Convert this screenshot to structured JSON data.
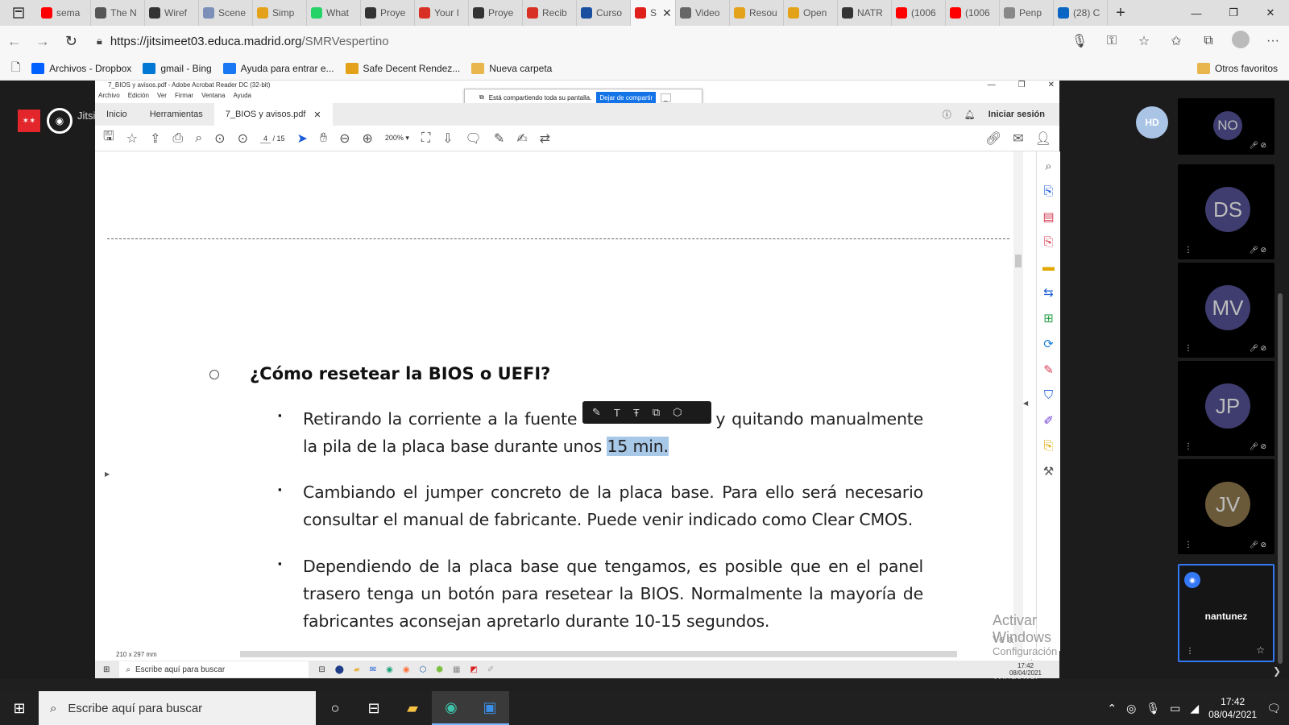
{
  "browser": {
    "tabs": [
      {
        "label": "sema",
        "icon": "youtube-icon",
        "color": "#ff0000"
      },
      {
        "label": "The N",
        "icon": "medium-icon",
        "color": "#555555"
      },
      {
        "label": "Wiref",
        "icon": "github-icon",
        "color": "#333333"
      },
      {
        "label": "Scene",
        "icon": "globe-icon",
        "color": "#7b8fb8"
      },
      {
        "label": "Simp",
        "icon": "fox-icon",
        "color": "#e3a21a"
      },
      {
        "label": "What",
        "icon": "whatsapp-icon",
        "color": "#25d366"
      },
      {
        "label": "Proye",
        "icon": "notebook-icon",
        "color": "#333333"
      },
      {
        "label": "Your I",
        "icon": "gmail-icon",
        "color": "#d93025"
      },
      {
        "label": "Proye",
        "icon": "notebook-icon",
        "color": "#333333"
      },
      {
        "label": "Recib",
        "icon": "gmail-icon",
        "color": "#d93025"
      },
      {
        "label": "Curso",
        "icon": "graduation-icon",
        "color": "#1a4fa0"
      },
      {
        "label": "S",
        "icon": "record-icon",
        "color": "#e0201b",
        "active": true
      },
      {
        "label": "Video",
        "icon": "shield-icon",
        "color": "#666666"
      },
      {
        "label": "Resou",
        "icon": "smiley-icon",
        "color": "#e3a21a"
      },
      {
        "label": "Open",
        "icon": "fox-icon",
        "color": "#e3a21a"
      },
      {
        "label": "NATR",
        "icon": "circle-icon",
        "color": "#333333"
      },
      {
        "label": "(1006",
        "icon": "youtube-icon",
        "color": "#ff0000"
      },
      {
        "label": "(1006",
        "icon": "youtube-icon",
        "color": "#ff0000"
      },
      {
        "label": "Penp",
        "icon": "box-icon",
        "color": "#888888"
      },
      {
        "label": "(28) C",
        "icon": "mail-icon",
        "color": "#0a66c2"
      }
    ],
    "url_host": "https://jitsimeet03.educa.madrid.org",
    "url_path": "/SMRVespertino",
    "favorites": [
      {
        "label": "Archivos - Dropbox",
        "icon": "dropbox-icon",
        "color": "#0061ff"
      },
      {
        "label": "gmail - Bing",
        "icon": "bing-icon",
        "color": "#0078d4"
      },
      {
        "label": "Ayuda para entrar e...",
        "icon": "facebook-icon",
        "color": "#1877f2"
      },
      {
        "label": "Safe Decent Rendez...",
        "icon": "fox-icon",
        "color": "#e3a21a"
      },
      {
        "label": "Nueva carpeta",
        "icon": "folder-icon",
        "color": "#e8b64c"
      }
    ],
    "other_favorites": "Otros favoritos"
  },
  "meeting": {
    "participants": [
      {
        "initials": "NO"
      },
      {
        "initials": "DS"
      },
      {
        "initials": "MV"
      },
      {
        "initials": "JP"
      },
      {
        "initials": "JV"
      }
    ],
    "self_initials": "HD",
    "active_speaker": "nantunez",
    "logo_text": "Jitsi Ed"
  },
  "acrobat": {
    "window_title": "7_BIOS y avisos.pdf - Adobe Acrobat Reader DC (32-bit)",
    "menu": [
      "Archivo",
      "Edición",
      "Ver",
      "Firmar",
      "Ventana",
      "Ayuda"
    ],
    "share_notice": "Está compartiendo toda su pantalla.",
    "stop_share": "Dejar de compartir",
    "tabs": [
      "Inicio",
      "Herramientas",
      "7_BIOS y avisos.pdf"
    ],
    "sign_in": "Iniciar sesión",
    "page_current": "4",
    "page_total": "/ 15",
    "zoom": "200%",
    "page_size": "210 x 297 mm",
    "heading": "¿Cómo resetear la BIOS o UEFI?",
    "bullets": [
      {
        "pre": "Retirando la corriente a la fuente",
        "mid": "y quitando manualmente la pila de la placa base durante unos",
        "highlight": "15 min."
      },
      {
        "text": "Cambiando el jumper concreto de la placa base. Para ello será necesario consultar el manual de fabricante. Puede venir indicado como Clear CMOS."
      },
      {
        "text": "Dependiendo de la placa base que tengamos, es posible que en el panel trasero tenga un botón para resetear la BIOS. Normalmente la mayoría de fabricantes aconsejan apretarlo durante 10-15 segundos."
      }
    ],
    "watermark_title": "Activar Windows",
    "watermark_sub": "Ve a Configuración para activar Windows.",
    "inner_search": "Escribe aquí para buscar",
    "inner_time": "17:42",
    "inner_date": "08/04/2021"
  },
  "taskbar": {
    "search": "Escribe aquí para buscar",
    "time": "17:42",
    "date": "08/04/2021"
  }
}
